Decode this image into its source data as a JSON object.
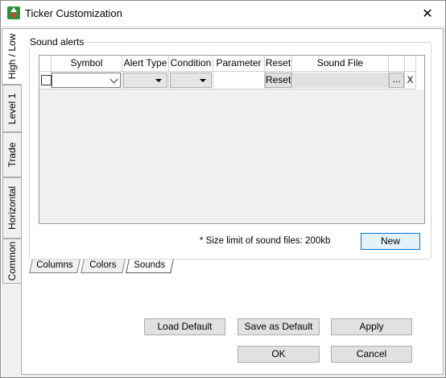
{
  "window": {
    "title": "Ticker Customization",
    "close_glyph": "✕"
  },
  "side_tabs": [
    {
      "label": "High / Low",
      "active": true
    },
    {
      "label": "Level 1",
      "active": false
    },
    {
      "label": "Trade",
      "active": false
    },
    {
      "label": "Horizontal",
      "active": false
    },
    {
      "label": "Common",
      "active": false
    }
  ],
  "sound_alerts": {
    "group_title": "Sound alerts",
    "columns": [
      "Symbol",
      "Alert Type",
      "Condition",
      "Parameter",
      "Reset",
      "Sound File"
    ],
    "row": {
      "checked": false,
      "symbol": "",
      "alert_type": "",
      "condition": "",
      "parameter": "",
      "reset_label": "Reset",
      "sound_file": "",
      "browse_label": "...",
      "delete_label": "X"
    },
    "size_note": "* Size limit of sound files: 200kb",
    "new_label": "New"
  },
  "bottom_tabs": [
    {
      "label": "Columns",
      "active": false
    },
    {
      "label": "Colors",
      "active": false
    },
    {
      "label": "Sounds",
      "active": true
    }
  ],
  "buttons": {
    "load_default": "Load Default",
    "save_default": "Save as Default",
    "apply": "Apply",
    "ok": "OK",
    "cancel": "Cancel"
  },
  "icons": {
    "app": "up-down-arrows-icon",
    "close": "close-icon",
    "dropdown": "chevron-down-icon"
  },
  "colors": {
    "accent": "#0078d7",
    "tab_face": "#f0f0f0",
    "button_face": "#e1e1e1",
    "app_icon_green": "#2f8f3a",
    "app_icon_red": "#e23b2e"
  }
}
